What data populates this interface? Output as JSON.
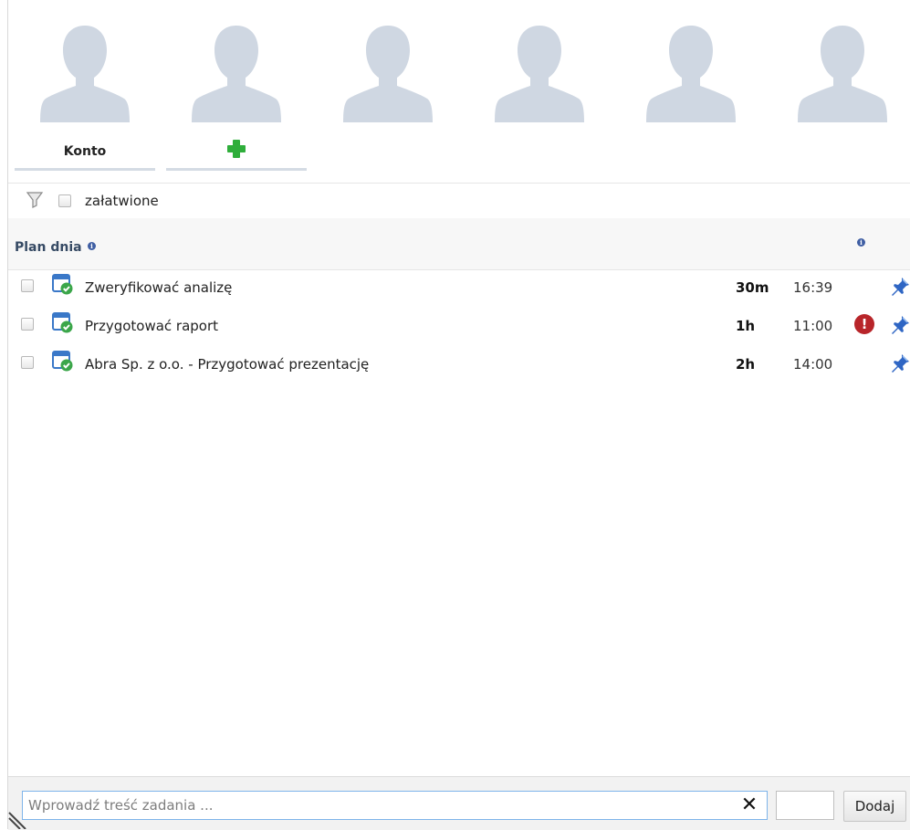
{
  "avatars": [
    {
      "icon": "person-icon"
    },
    {
      "icon": "person-icon"
    },
    {
      "icon": "person-icon"
    },
    {
      "icon": "person-icon"
    },
    {
      "icon": "person-icon"
    },
    {
      "icon": "person-icon"
    }
  ],
  "tabs": [
    {
      "label": "Konto"
    },
    {
      "label": "",
      "icon": "plus-icon"
    }
  ],
  "filter": {
    "icon": "filter-icon",
    "checkbox_label": "załatwione",
    "checked": false
  },
  "plan": {
    "title": "Plan dnia",
    "info_icon": "info-icon",
    "column_info_icon": "info-icon"
  },
  "tasks": [
    {
      "title": "Zweryfikować analizę",
      "duration": "30m",
      "time": "16:39",
      "alert": false,
      "checked": false
    },
    {
      "title": "Przygotować raport",
      "duration": "1h",
      "time": "11:00",
      "alert": true,
      "checked": false
    },
    {
      "title": "Abra Sp. z o.o. - Przygotować prezentację",
      "duration": "2h",
      "time": "14:00",
      "alert": false,
      "checked": false
    }
  ],
  "footer": {
    "input_placeholder": "Wprowadź treść zadania ...",
    "input_value": "",
    "clear_label": "✕",
    "add_label": "Dodaj"
  },
  "colors": {
    "accent_plus": "#2fae3b",
    "alert": "#b8252a",
    "title_blue": "#364a64",
    "avatar": "#cfd7e2"
  }
}
